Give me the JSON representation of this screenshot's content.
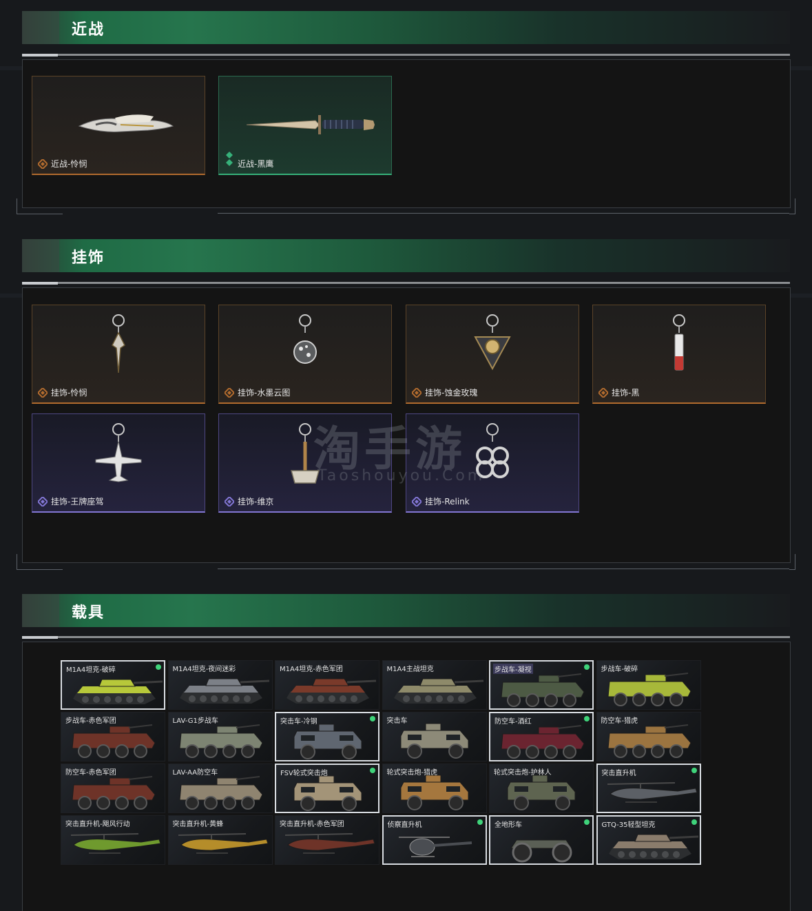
{
  "sections": {
    "melee": {
      "title": "近战",
      "items": [
        {
          "label": "近战-怜悯",
          "rarity": "orange"
        },
        {
          "label": "近战-黑鹰",
          "rarity": "green"
        }
      ]
    },
    "charms": {
      "title": "挂饰",
      "items": [
        {
          "label": "挂饰-怜悯",
          "rarity": "orange"
        },
        {
          "label": "挂饰-水墨云图",
          "rarity": "orange"
        },
        {
          "label": "挂饰-蚀金玫瑰",
          "rarity": "orange"
        },
        {
          "label": "挂饰-黑",
          "rarity": "orange"
        },
        {
          "label": "挂饰-王牌座驾",
          "rarity": "purple"
        },
        {
          "label": "挂饰-维京",
          "rarity": "purple"
        },
        {
          "label": "挂饰-Relink",
          "rarity": "purple"
        }
      ]
    },
    "vehicles": {
      "title": "载具",
      "items": [
        {
          "label": "M1A4坦克-破碎",
          "kind": "tank",
          "color": "#b7c83a",
          "owned": true
        },
        {
          "label": "M1A4坦克-夜间迷彩",
          "kind": "tank",
          "color": "#7c8087",
          "owned": false
        },
        {
          "label": "M1A4坦克-赤色军团",
          "kind": "tank",
          "color": "#7a3a2a",
          "owned": false
        },
        {
          "label": "M1A4主战坦克",
          "kind": "tank",
          "color": "#8e8a6a",
          "owned": false
        },
        {
          "label": "步战车-凝视",
          "kind": "apc",
          "color": "#4d5a44",
          "owned": true,
          "highlight": true
        },
        {
          "label": "步战车-破碎",
          "kind": "apc",
          "color": "#a7b83a",
          "owned": false
        },
        {
          "label": "步战车-赤色军团",
          "kind": "apc",
          "color": "#6e3328",
          "owned": false
        },
        {
          "label": "LAV-G1步战车",
          "kind": "apc",
          "color": "#7d8472",
          "owned": false
        },
        {
          "label": "突击车-冷钢",
          "kind": "mrap",
          "color": "#5f6670",
          "owned": true
        },
        {
          "label": "突击车",
          "kind": "mrap",
          "color": "#8d8a78",
          "owned": false
        },
        {
          "label": "防空车-酒红",
          "kind": "apc",
          "color": "#6b2430",
          "owned": true
        },
        {
          "label": "防空车-猎虎",
          "kind": "apc",
          "color": "#9b7440",
          "owned": false
        },
        {
          "label": "防空车-赤色军团",
          "kind": "apc",
          "color": "#6e3328",
          "owned": false
        },
        {
          "label": "LAV-AA防空车",
          "kind": "apc",
          "color": "#8f8470",
          "owned": false
        },
        {
          "label": "FSV轮式突击炮",
          "kind": "mrap",
          "color": "#a39478",
          "owned": true
        },
        {
          "label": "轮式突击炮-猎虎",
          "kind": "mrap",
          "color": "#a5773e",
          "owned": false
        },
        {
          "label": "轮式突击炮-护林人",
          "kind": "mrap",
          "color": "#5e6450",
          "owned": false
        },
        {
          "label": "突击直升机",
          "kind": "heli",
          "color": "#5c6066",
          "owned": true
        },
        {
          "label": "突击直升机-飓风行动",
          "kind": "heli",
          "color": "#6f9a2e",
          "owned": false
        },
        {
          "label": "突击直升机-黄蜂",
          "kind": "heli",
          "color": "#b58d2a",
          "owned": false
        },
        {
          "label": "突击直升机-赤色军团",
          "kind": "heli",
          "color": "#6e3328",
          "owned": false
        },
        {
          "label": "侦察直升机",
          "kind": "scout",
          "color": "#4a4d52",
          "owned": true
        },
        {
          "label": "全地形车",
          "kind": "atv",
          "color": "#5a5f55",
          "owned": true
        },
        {
          "label": "GTQ-35轻型坦克",
          "kind": "tank",
          "color": "#8a7c6c",
          "owned": true
        }
      ]
    }
  },
  "watermark": {
    "brand_cn": "淘手游",
    "brand_en": "Taoshouyou.Com"
  },
  "colors": {
    "rarity_orange": "#b36c2e",
    "rarity_green": "#36b17a",
    "rarity_purple": "#8377d6",
    "owned_dot": "#3fd37a"
  }
}
